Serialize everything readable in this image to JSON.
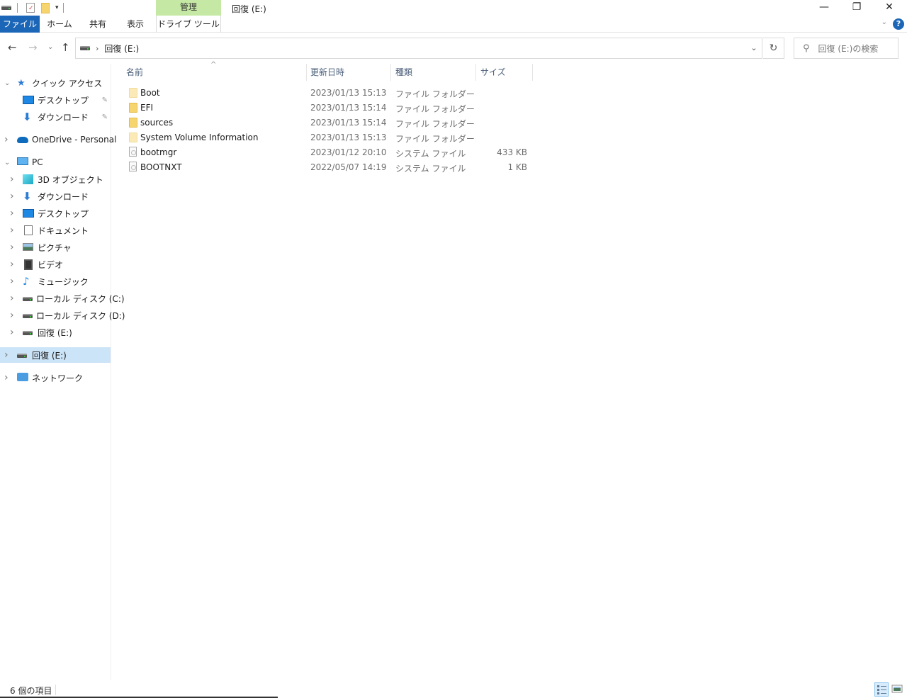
{
  "window": {
    "title": "回復 (E:)",
    "context_tab_group": "管理",
    "controls": {
      "minimize": "—",
      "restore": "❐",
      "close": "✕"
    }
  },
  "ribbon": {
    "tabs": [
      {
        "label": "ファイル",
        "active": true
      },
      {
        "label": "ホーム"
      },
      {
        "label": "共有"
      },
      {
        "label": "表示"
      },
      {
        "label": "ドライブ ツール"
      }
    ],
    "help": "?",
    "collapse": "⌄"
  },
  "navigation": {
    "back": "←",
    "forward": "→",
    "recent": "⌄",
    "up": "↑",
    "breadcrumb": [
      "回復 (E:)"
    ],
    "refresh": "↻",
    "search_placeholder": "回復 (E:)の検索"
  },
  "sidebar": {
    "items": [
      {
        "label": "クイック アクセス",
        "icon": "star-icon",
        "expanded": true
      },
      {
        "label": "デスクトップ",
        "icon": "desktop-icon",
        "pinned": true
      },
      {
        "label": "ダウンロード",
        "icon": "download-icon",
        "pinned": true
      },
      {
        "label": "OneDrive - Personal",
        "icon": "cloud-icon"
      },
      {
        "label": "PC",
        "icon": "pc-icon",
        "expanded": true
      },
      {
        "label": "3D オブジェクト",
        "icon": "cube-icon"
      },
      {
        "label": "ダウンロード",
        "icon": "download-icon"
      },
      {
        "label": "デスクトップ",
        "icon": "desktop-icon"
      },
      {
        "label": "ドキュメント",
        "icon": "document-icon"
      },
      {
        "label": "ピクチャ",
        "icon": "picture-icon"
      },
      {
        "label": "ビデオ",
        "icon": "video-icon"
      },
      {
        "label": "ミュージック",
        "icon": "music-icon"
      },
      {
        "label": "ローカル ディスク (C:)",
        "icon": "windows-drive-icon"
      },
      {
        "label": "ローカル ディスク (D:)",
        "icon": "drive-icon"
      },
      {
        "label": "回復 (E:)",
        "icon": "drive-icon"
      },
      {
        "label": "回復 (E:)",
        "icon": "drive-icon",
        "selected": true
      },
      {
        "label": "ネットワーク",
        "icon": "network-icon"
      }
    ],
    "pin_glyph": "📌"
  },
  "file_list": {
    "columns": [
      "名前",
      "更新日時",
      "種類",
      "サイズ"
    ],
    "sort_indicator": "^",
    "rows": [
      {
        "name": "Boot",
        "date": "2023/01/13 15:13",
        "type": "ファイル フォルダー",
        "size": "",
        "kind": "folder",
        "hidden": true
      },
      {
        "name": "EFI",
        "date": "2023/01/13 15:14",
        "type": "ファイル フォルダー",
        "size": "",
        "kind": "folder"
      },
      {
        "name": "sources",
        "date": "2023/01/13 15:14",
        "type": "ファイル フォルダー",
        "size": "",
        "kind": "folder"
      },
      {
        "name": "System Volume Information",
        "date": "2023/01/13 15:13",
        "type": "ファイル フォルダー",
        "size": "",
        "kind": "folder",
        "hidden": true
      },
      {
        "name": "bootmgr",
        "date": "2023/01/12 20:10",
        "type": "システム ファイル",
        "size": "433 KB",
        "kind": "file"
      },
      {
        "name": "BOOTNXT",
        "date": "2022/05/07 14:19",
        "type": "システム ファイル",
        "size": "1 KB",
        "kind": "file"
      }
    ]
  },
  "status": {
    "item_count": "6 個の項目"
  }
}
